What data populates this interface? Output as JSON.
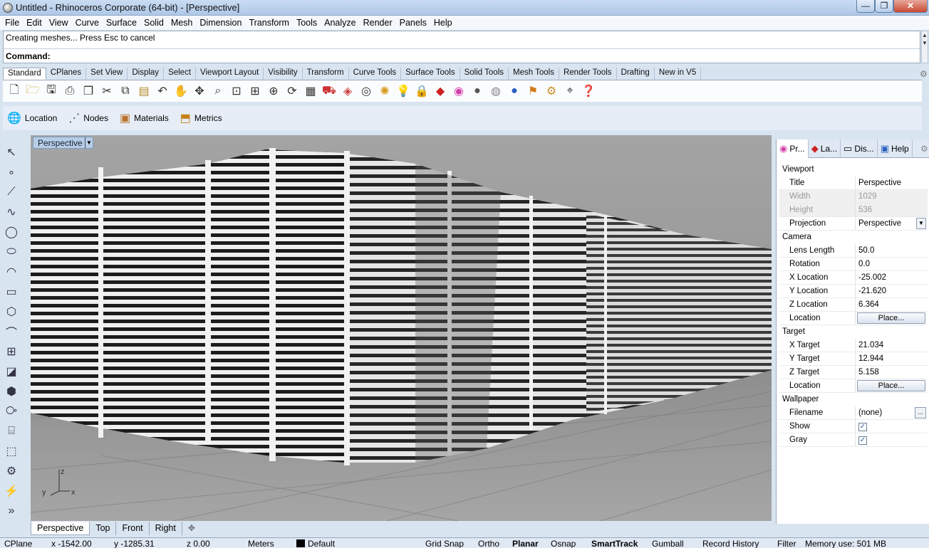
{
  "window": {
    "title": "Untitled - Rhinoceros Corporate (64-bit) - [Perspective]",
    "min": "—",
    "max": "❐",
    "close": "✕"
  },
  "menu": [
    "File",
    "Edit",
    "View",
    "Curve",
    "Surface",
    "Solid",
    "Mesh",
    "Dimension",
    "Transform",
    "Tools",
    "Analyze",
    "Render",
    "Panels",
    "Help"
  ],
  "command": {
    "history": "Creating meshes... Press Esc to cancel",
    "prompt": "Command:"
  },
  "toolbar_tabs": [
    "Standard",
    "CPlanes",
    "Set View",
    "Display",
    "Select",
    "Viewport Layout",
    "Visibility",
    "Transform",
    "Curve Tools",
    "Surface Tools",
    "Solid Tools",
    "Mesh Tools",
    "Render Tools",
    "Drafting",
    "New in V5"
  ],
  "standard_icons": [
    "new-file-icon",
    "open-folder-icon",
    "save-icon",
    "print-icon",
    "copy-page-icon",
    "cut-icon",
    "copy-icon",
    "paste-icon",
    "undo-icon",
    "pan-hand-icon",
    "move-icon",
    "zoom-icon",
    "zoom-window-icon",
    "zoom-extents-icon",
    "zoom-selected-icon",
    "rotate-view-icon",
    "grid-icon",
    "car-icon",
    "mesh-icon",
    "target-icon",
    "lights-icon",
    "bulb-icon",
    "lock-icon",
    "layer-icon",
    "color-wheel-icon",
    "sphere-shade-icon",
    "sphere-render-icon",
    "sphere-blue-icon",
    "flag-icon",
    "gear-tool-icon",
    "snap-icon",
    "help-icon"
  ],
  "secondary_toolbar": [
    {
      "icon": "globe-icon",
      "label": "Location"
    },
    {
      "icon": "nodes-icon",
      "label": "Nodes"
    },
    {
      "icon": "materials-icon",
      "label": "Materials"
    },
    {
      "icon": "metrics-icon",
      "label": "Metrics"
    }
  ],
  "viewport": {
    "label": "Perspective",
    "axis_x": "x",
    "axis_y": "y",
    "axis_z": "z"
  },
  "viewport_tabs": [
    "Perspective",
    "Top",
    "Front",
    "Right"
  ],
  "viewport_tab_add": "✥",
  "panel": {
    "tabs": [
      "Pr...",
      "La...",
      "Dis...",
      "Help"
    ],
    "sections": {
      "viewport": "Viewport",
      "camera": "Camera",
      "target": "Target",
      "wallpaper": "Wallpaper"
    },
    "title_label": "Title",
    "title_value": "Perspective",
    "width_label": "Width",
    "width_value": "1029",
    "height_label": "Height",
    "height_value": "536",
    "projection_label": "Projection",
    "projection_value": "Perspective",
    "lens_label": "Lens Length",
    "lens_value": "50.0",
    "rotation_label": "Rotation",
    "rotation_value": "0.0",
    "xloc_label": "X Location",
    "xloc_value": "-25.002",
    "yloc_label": "Y Location",
    "yloc_value": "-21.620",
    "zloc_label": "Z Location",
    "zloc_value": "6.364",
    "location_label": "Location",
    "place_button": "Place...",
    "xt_label": "X Target",
    "xt_value": "21.034",
    "yt_label": "Y Target",
    "yt_value": "12.944",
    "zt_label": "Z Target",
    "zt_value": "5.158",
    "tloc_label": "Location",
    "filename_label": "Filename",
    "filename_value": "(none)",
    "show_label": "Show",
    "show_checked": true,
    "gray_label": "Gray",
    "gray_checked": true,
    "check_mark": "✓",
    "more_button": "..."
  },
  "status": {
    "cplane": "CPlane",
    "x": "x -1542.00",
    "y": "y -1285.31",
    "z": "z 0.00",
    "units": "Meters",
    "layer": "Default",
    "grid_snap": "Grid Snap",
    "ortho": "Ortho",
    "planar": "Planar",
    "osnap": "Osnap",
    "smarttrack": "SmartTrack",
    "gumball": "Gumball",
    "record_history": "Record History",
    "filter": "Filter",
    "memory": "Memory use: 501 MB"
  }
}
